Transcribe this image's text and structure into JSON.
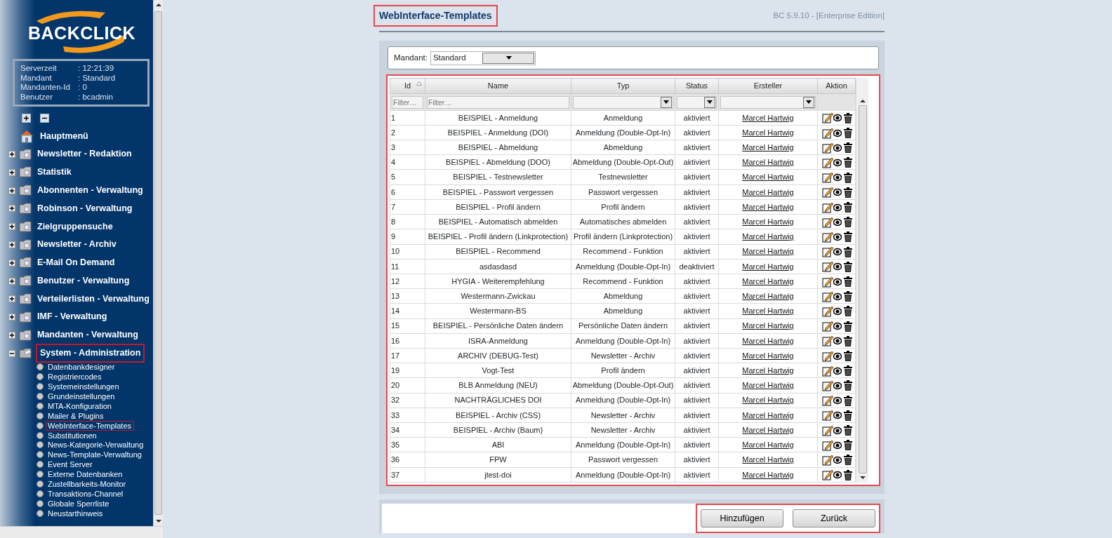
{
  "sidebar": {
    "logo": "BACKCLICK",
    "info": [
      {
        "label": "Serverzeit",
        "value": ":  12:21:39"
      },
      {
        "label": "Mandant",
        "value": ": Standard"
      },
      {
        "label": "Mandanten-Id",
        "value": ": 0"
      },
      {
        "label": "Benutzer",
        "value": ": bcadmin"
      }
    ],
    "items": [
      {
        "label": "Hauptmenü",
        "kind": "home"
      },
      {
        "label": "Newsletter - Redaktion",
        "kind": "folder",
        "expanded": false,
        "highlighted": false
      },
      {
        "label": "Statistik",
        "kind": "folder",
        "expanded": false,
        "highlighted": false
      },
      {
        "label": "Abonnenten - Verwaltung",
        "kind": "folder",
        "expanded": false,
        "highlighted": false
      },
      {
        "label": "Robinson - Verwaltung",
        "kind": "folder",
        "expanded": false,
        "highlighted": false
      },
      {
        "label": "Zielgruppensuche",
        "kind": "folder",
        "expanded": false,
        "highlighted": false
      },
      {
        "label": "Newsletter - Archiv",
        "kind": "folder",
        "expanded": false,
        "highlighted": false
      },
      {
        "label": "E-Mail On Demand",
        "kind": "folder",
        "expanded": false,
        "highlighted": false
      },
      {
        "label": "Benutzer - Verwaltung",
        "kind": "folder",
        "expanded": false,
        "highlighted": false
      },
      {
        "label": "Verteilerlisten - Verwaltung",
        "kind": "folder",
        "expanded": false,
        "highlighted": false
      },
      {
        "label": "IMF - Verwaltung",
        "kind": "folder",
        "expanded": false,
        "highlighted": false
      },
      {
        "label": "Mandanten - Verwaltung",
        "kind": "folder",
        "expanded": false,
        "highlighted": false
      },
      {
        "label": "System - Administration",
        "kind": "folder",
        "expanded": true,
        "highlighted": true,
        "children": [
          {
            "label": "Datenbankdesigner",
            "highlighted": false
          },
          {
            "label": "Registriercodes",
            "highlighted": false
          },
          {
            "label": "Systemeinstellungen",
            "highlighted": false
          },
          {
            "label": "Grundeinstellungen",
            "highlighted": false
          },
          {
            "label": "MTA-Konfiguration",
            "highlighted": false
          },
          {
            "label": "Mailer & Plugins",
            "highlighted": false
          },
          {
            "label": "WebInterface-Templates",
            "highlighted": true
          },
          {
            "label": "Substitutionen",
            "highlighted": false
          },
          {
            "label": "News-Kategorie-Verwaltung",
            "highlighted": false
          },
          {
            "label": "News-Template-Verwaltung",
            "highlighted": false
          },
          {
            "label": "Event Server",
            "highlighted": false
          },
          {
            "label": "Externe Datenbanken",
            "highlighted": false
          },
          {
            "label": "Zustellbarkeits-Monitor",
            "highlighted": false
          },
          {
            "label": "Transaktions-Channel",
            "highlighted": false
          },
          {
            "label": "Globale Sperrliste",
            "highlighted": false
          },
          {
            "label": "Neustarthinweis",
            "highlighted": false
          }
        ]
      }
    ]
  },
  "page": {
    "title": "WebInterface-Templates",
    "title_highlighted": true,
    "version": "BC 5.9.10 - [Enterprise Edition]"
  },
  "mandant": {
    "label": "Mandant:",
    "value": "Standard"
  },
  "table": {
    "highlighted": true,
    "columns": [
      {
        "label": "Id",
        "sorted": true,
        "filter": {
          "kind": "text",
          "placeholder": "Filter…"
        }
      },
      {
        "label": "Name",
        "sorted": false,
        "filter": {
          "kind": "text",
          "placeholder": "Filter…"
        }
      },
      {
        "label": "Typ",
        "sorted": false,
        "filter": {
          "kind": "select"
        }
      },
      {
        "label": "Status",
        "sorted": false,
        "filter": {
          "kind": "select"
        }
      },
      {
        "label": "Ersteller",
        "sorted": false,
        "filter": {
          "kind": "select"
        }
      },
      {
        "label": "Aktion",
        "sorted": false,
        "filter": {
          "kind": "none"
        }
      }
    ],
    "rows": [
      [
        "1",
        "BEISPIEL - Anmeldung",
        "Anmeldung",
        "aktiviert",
        "Marcel Hartwig"
      ],
      [
        "2",
        "BEISPIEL - Anmeldung (DOI)",
        "Anmeldung (Double-Opt-In)",
        "aktiviert",
        "Marcel Hartwig"
      ],
      [
        "3",
        "BEISPIEL - Abmeldung",
        "Abmeldung",
        "aktiviert",
        "Marcel Hartwig"
      ],
      [
        "4",
        "BEISPIEL - Abmeldung (DOO)",
        "Abmeldung (Double-Opt-Out)",
        "aktiviert",
        "Marcel Hartwig"
      ],
      [
        "5",
        "BEISPIEL - Testnewsletter",
        "Testnewsletter",
        "aktiviert",
        "Marcel Hartwig"
      ],
      [
        "6",
        "BEISPIEL - Passwort vergessen",
        "Passwort vergessen",
        "aktiviert",
        "Marcel Hartwig"
      ],
      [
        "7",
        "BEISPIEL - Profil ändern",
        "Profil ändern",
        "aktiviert",
        "Marcel Hartwig"
      ],
      [
        "8",
        "BEISPIEL - Automatisch abmelden",
        "Automatisches abmelden",
        "aktiviert",
        "Marcel Hartwig"
      ],
      [
        "9",
        "BEISPIEL - Profil ändern (Linkprotection)",
        "Profil ändern (Linkprotection)",
        "aktiviert",
        "Marcel Hartwig"
      ],
      [
        "10",
        "BEISPIEL - Recommend",
        "Recommend - Funktion",
        "aktiviert",
        "Marcel Hartwig"
      ],
      [
        "11",
        "asdasdasd",
        "Anmeldung (Double-Opt-In)",
        "deaktiviert",
        "Marcel Hartwig"
      ],
      [
        "12",
        "HYGIA - Weiterempfehlung",
        "Recommend - Funktion",
        "aktiviert",
        "Marcel Hartwig"
      ],
      [
        "13",
        "Westermann-Zwickau",
        "Abmeldung",
        "aktiviert",
        "Marcel Hartwig"
      ],
      [
        "14",
        "Westermann-BS",
        "Abmeldung",
        "aktiviert",
        "Marcel Hartwig"
      ],
      [
        "15",
        "BEISPIEL - Persönliche Daten ändern",
        "Persönliche Daten ändern",
        "aktiviert",
        "Marcel Hartwig"
      ],
      [
        "16",
        "ISRA-Anmeldung",
        "Anmeldung (Double-Opt-In)",
        "aktiviert",
        "Marcel Hartwig"
      ],
      [
        "17",
        "ARCHIV (DEBUG-Test)",
        "Newsletter - Archiv",
        "aktiviert",
        "Marcel Hartwig"
      ],
      [
        "19",
        "Vogt-Test",
        "Profil ändern",
        "aktiviert",
        "Marcel Hartwig"
      ],
      [
        "20",
        "BLB Anmeldung (NEU)",
        "Abmeldung (Double-Opt-Out)",
        "aktiviert",
        "Marcel Hartwig"
      ],
      [
        "32",
        "NACHTRÄGLICHES DOI",
        "Anmeldung (Double-Opt-In)",
        "aktiviert",
        "Marcel Hartwig"
      ],
      [
        "33",
        "BEISPIEL - Archiv (CSS)",
        "Newsletter - Archiv",
        "aktiviert",
        "Marcel Hartwig"
      ],
      [
        "34",
        "BEISPIEL - Archiv (Baum)",
        "Newsletter - Archiv",
        "aktiviert",
        "Marcel Hartwig"
      ],
      [
        "35",
        "ABI",
        "Anmeldung (Double-Opt-In)",
        "aktiviert",
        "Marcel Hartwig"
      ],
      [
        "36",
        "FPW",
        "Passwort vergessen",
        "aktiviert",
        "Marcel Hartwig"
      ],
      [
        "37",
        "jtest-doi",
        "Anmeldung (Double-Opt-In)",
        "aktiviert",
        "Marcel Hartwig"
      ]
    ]
  },
  "buttons": {
    "highlighted": true,
    "items": [
      "Hinzufügen",
      "Zurück"
    ]
  }
}
